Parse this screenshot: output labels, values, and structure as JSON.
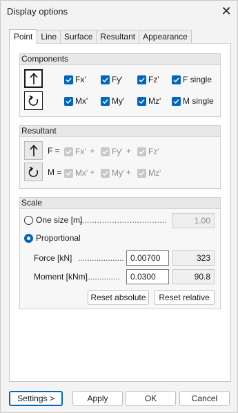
{
  "window": {
    "title": "Display options",
    "close_glyph": "✕"
  },
  "tabs": [
    {
      "label": "Point",
      "active": true
    },
    {
      "label": "Line",
      "active": false
    },
    {
      "label": "Surface",
      "active": false
    },
    {
      "label": "Resultant",
      "active": false
    },
    {
      "label": "Appearance",
      "active": false
    }
  ],
  "components": {
    "header": "Components",
    "row1": [
      {
        "label": "Fx'",
        "checked": true
      },
      {
        "label": "Fy'",
        "checked": true
      },
      {
        "label": "Fz'",
        "checked": true
      },
      {
        "label": "F single",
        "checked": true
      }
    ],
    "row2": [
      {
        "label": "Mx'",
        "checked": true
      },
      {
        "label": "My'",
        "checked": true
      },
      {
        "label": "Mz'",
        "checked": true
      },
      {
        "label": "M single",
        "checked": true
      }
    ]
  },
  "resultant": {
    "header": "Resultant",
    "force_prefix": "F =",
    "moment_prefix": "M =",
    "plus": "+",
    "row1": [
      {
        "label": "Fx'",
        "checked": true,
        "enabled": false
      },
      {
        "label": "Fy'",
        "checked": true,
        "enabled": false
      },
      {
        "label": "Fz'",
        "checked": true,
        "enabled": false
      }
    ],
    "row2": [
      {
        "label": "Mx'",
        "checked": true,
        "enabled": false
      },
      {
        "label": "My'",
        "checked": true,
        "enabled": false
      },
      {
        "label": "Mz'",
        "checked": true,
        "enabled": false
      }
    ]
  },
  "scale": {
    "header": "Scale",
    "one_size": {
      "label": "One size [m]",
      "leader": "...................................",
      "value": "1.00",
      "selected": false
    },
    "proportional": {
      "label": "Proportional",
      "selected": true
    },
    "force": {
      "label": "Force [kN]",
      "leader": "....................",
      "value": "0.00700",
      "computed": "323"
    },
    "moment": {
      "label": "Moment [kNm]",
      "leader": "...............",
      "value": "0.0300",
      "computed": "90.8"
    },
    "reset_absolute_label": "Reset absolute",
    "reset_relative_label": "Reset relative"
  },
  "footer": {
    "settings_label": "Settings >",
    "apply_label": "Apply",
    "ok_label": "OK",
    "cancel_label": "Cancel"
  },
  "icons": {
    "force_arrow": "arrow-up-icon",
    "moment_rotate": "rotate-icon",
    "check": "checkmark-icon"
  },
  "colors": {
    "accent": "#0067c0",
    "disabled_check": "#c8c8c8"
  }
}
